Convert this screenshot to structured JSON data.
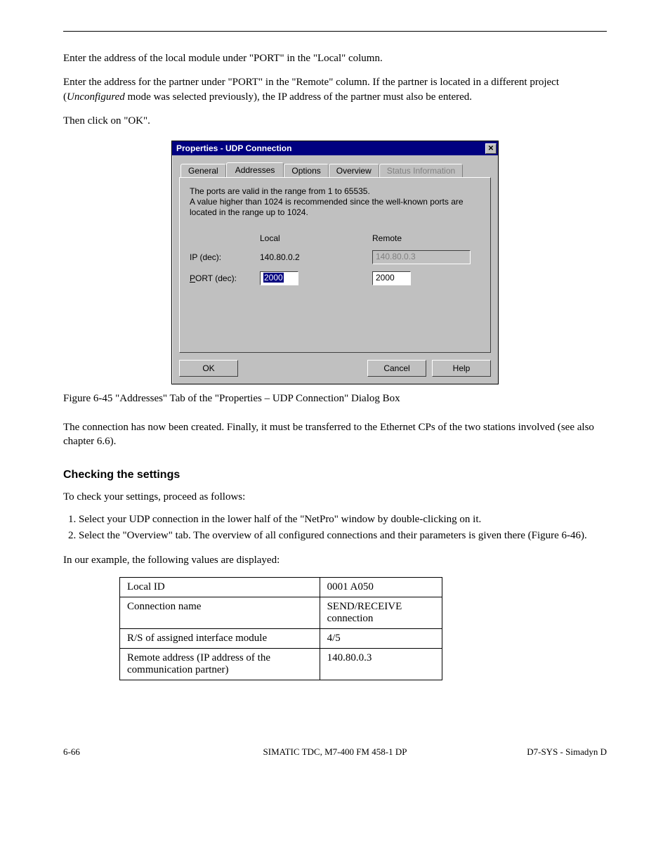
{
  "meta": {
    "header_right": ""
  },
  "intro": {
    "p1": "Enter the address of the local module under \"PORT\" in the \"Local\" column.",
    "p2_a": "Enter the address for the partner under \"PORT\" in the \"Remote\" column. If the partner is located in a different project (",
    "p2_unconfigured": "Unconfigured",
    "p2_b": " mode was selected previously), the IP address of the partner must also be entered.",
    "p3": "Then click on \"OK\"."
  },
  "dialog": {
    "title": "Properties - UDP Connection",
    "close_glyph": "✕",
    "tabs": {
      "general": "General",
      "addresses": "Addresses",
      "options": "Options",
      "overview": "Overview",
      "status": "Status Information"
    },
    "info_lines": {
      "l1": "The ports are valid in the range from 1 to 65535.",
      "l2": "A value higher than 1024 is recommended since the well-known ports are located in the range up to 1024."
    },
    "col_local": "Local",
    "col_remote": "Remote",
    "row_ip_label_pre": "IP (dec):",
    "row_port_label_u": "P",
    "row_port_label_rest": "ORT (dec):",
    "ip_local": "140.80.0.2",
    "ip_remote": "140.80.0.3",
    "port_local": "2000",
    "port_remote": "2000",
    "btn_ok": "OK",
    "btn_cancel": "Cancel",
    "btn_help": "Help"
  },
  "figure": {
    "caption": "Figure 6-45  \"Addresses\" Tab of the \"Properties – UDP Connection\" Dialog Box"
  },
  "after": {
    "p1": "The connection has now been created. Finally, it must be transferred to the Ethernet CPs of the two stations involved (see also chapter 6.6)."
  },
  "section": {
    "head": "Checking the settings",
    "lead": "To check your settings, proceed as follows:",
    "steps": [
      "Select your UDP connection in the lower half of the \"NetPro\" window by double-clicking on it.",
      "Select the \"Overview\" tab. The overview of all configured connections and their parameters is given there (Figure 6-46)."
    ],
    "table_lead": "In our example, the following values are displayed:",
    "table": [
      {
        "c1": "Local ID",
        "c2": "0001 A050"
      },
      {
        "c1": "Connection name",
        "c2": "SEND/RECEIVE connection"
      },
      {
        "c1": "R/S of assigned interface module",
        "c2": "4/5"
      },
      {
        "c1": "Remote address (IP address of the communication partner)",
        "c2": "140.80.0.3"
      }
    ]
  },
  "footer": {
    "left": "6-66",
    "center": "SIMATIC TDC, M7-400 FM 458-1 DP",
    "right": "D7-SYS - Simadyn D"
  }
}
